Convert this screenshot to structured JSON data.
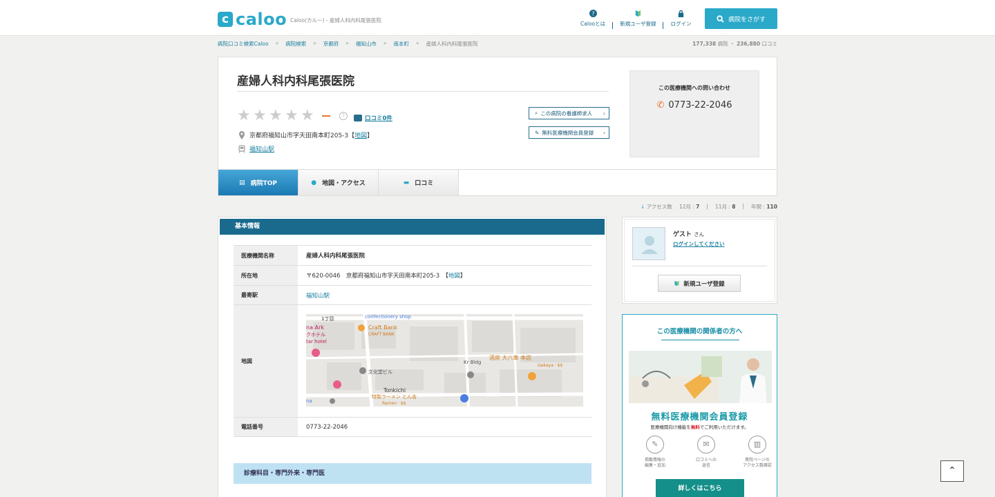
{
  "header": {
    "logo_mark": "c",
    "logo_text": "caloo",
    "tagline": "Caloo(カルー) - 産婦人科内科尾張医院",
    "nav": [
      {
        "label": "Calooとは",
        "icon": "question-icon"
      },
      {
        "label": "新規ユーザ登録",
        "icon": "beginner-icon"
      },
      {
        "label": "ログイン",
        "icon": "lock-icon"
      }
    ],
    "search_button": "病院をさがす"
  },
  "breadcrumb": [
    "病院口コミ検索Caloo",
    "京都府",
    "福知山市",
    "南本町",
    "産婦人科内科尾張医院"
  ],
  "breadcrumb_extra": "病院検索",
  "counts": {
    "hospitals": "177,338",
    "hospitals_unit": "病院",
    "reviews": "236,880",
    "reviews_unit": "口コミ",
    "sep": "・"
  },
  "hospital": {
    "name": "産婦人科内科尾張医院",
    "rating": "—",
    "help": "?",
    "review_link": "口コミ0件",
    "address": "京都府福知山市字天田南本町205-3【",
    "address_map": "地図",
    "address_end": "】",
    "station": "福知山駅",
    "nurse_button": "この病院の看護師求人",
    "register_button": "無料医療機関会員登録",
    "contact_title": "この医療機関への問い合わせ",
    "phone": "0773-22-2046"
  },
  "tabs": [
    {
      "label": "病院TOP",
      "icon": "hospital-icon",
      "active": true
    },
    {
      "label": "地図・アクセス",
      "icon": "map-pin-icon",
      "active": false
    },
    {
      "label": "口コミ",
      "icon": "speech-bubble-icon",
      "active": false
    }
  ],
  "access": {
    "label": "アクセス数",
    "dec_label": "12月 :",
    "dec": "7",
    "nov_label": "11月 :",
    "nov": "8",
    "year_label": "年間 :",
    "year": "110",
    "sep": "|"
  },
  "basic_info": {
    "heading": "基本情報",
    "rows": [
      {
        "label": "医療機関名称",
        "value": "産婦人科内科尾張医院"
      },
      {
        "label": "所在地",
        "value": "〒620-0046　京都府福知山市字天田南本町205-3　【",
        "link": "地図",
        "end": "】"
      },
      {
        "label": "最寄駅",
        "value": "福知山駅"
      },
      {
        "label": "地図",
        "value": ""
      },
      {
        "label": "電話番号",
        "value": "0773-22-2046"
      }
    ],
    "map_labels": {
      "confectionery": "confectionery shop",
      "chome": "1丁目",
      "ark": "na Ark",
      "hotel_jp": "クホテル",
      "hotel_en": "tar hotel",
      "craft_bank": "Craft Bank",
      "craft_bank_en": "CRAFT BANK",
      "bunka": "文化堂ビル",
      "kr_bldg": "Kr Bldg",
      "izakaya_jp": "酒房 大八車 本店",
      "izakaya_en": "Izakaya · $$",
      "tonkichi": "Tonkichi",
      "tonkichi_jp": "特製ラーメン とん吉",
      "tonkichi_en": "Ramen · $$",
      "edge": "na"
    }
  },
  "section2": "診療科目・専門外来・専門医",
  "user": {
    "name": "ゲスト",
    "honorific": "さん",
    "login_link": "ログインしてください",
    "register": "新規ユーザ登録"
  },
  "promo": {
    "title": "この医療機関の関係者の方へ",
    "headline": "無料医療機関会員登録",
    "sub_pre": "医療機関向け機能を",
    "sub_em": "無料",
    "sub_post": "でご利用いただけます。",
    "features": [
      {
        "line1": "掲載情報の",
        "line2": "編集・追加",
        "icon": "pencil-icon"
      },
      {
        "line1": "口コミへの",
        "line2": "返信",
        "icon": "chat-icon"
      },
      {
        "line1": "貴院ページの",
        "line2": "アクセス数確認",
        "icon": "bar-chart-icon"
      }
    ],
    "button": "詳しくはこちら"
  },
  "colors": {
    "accent": "#2aa9c9",
    "navy": "#1a6a8e",
    "orange": "#e8762c"
  }
}
